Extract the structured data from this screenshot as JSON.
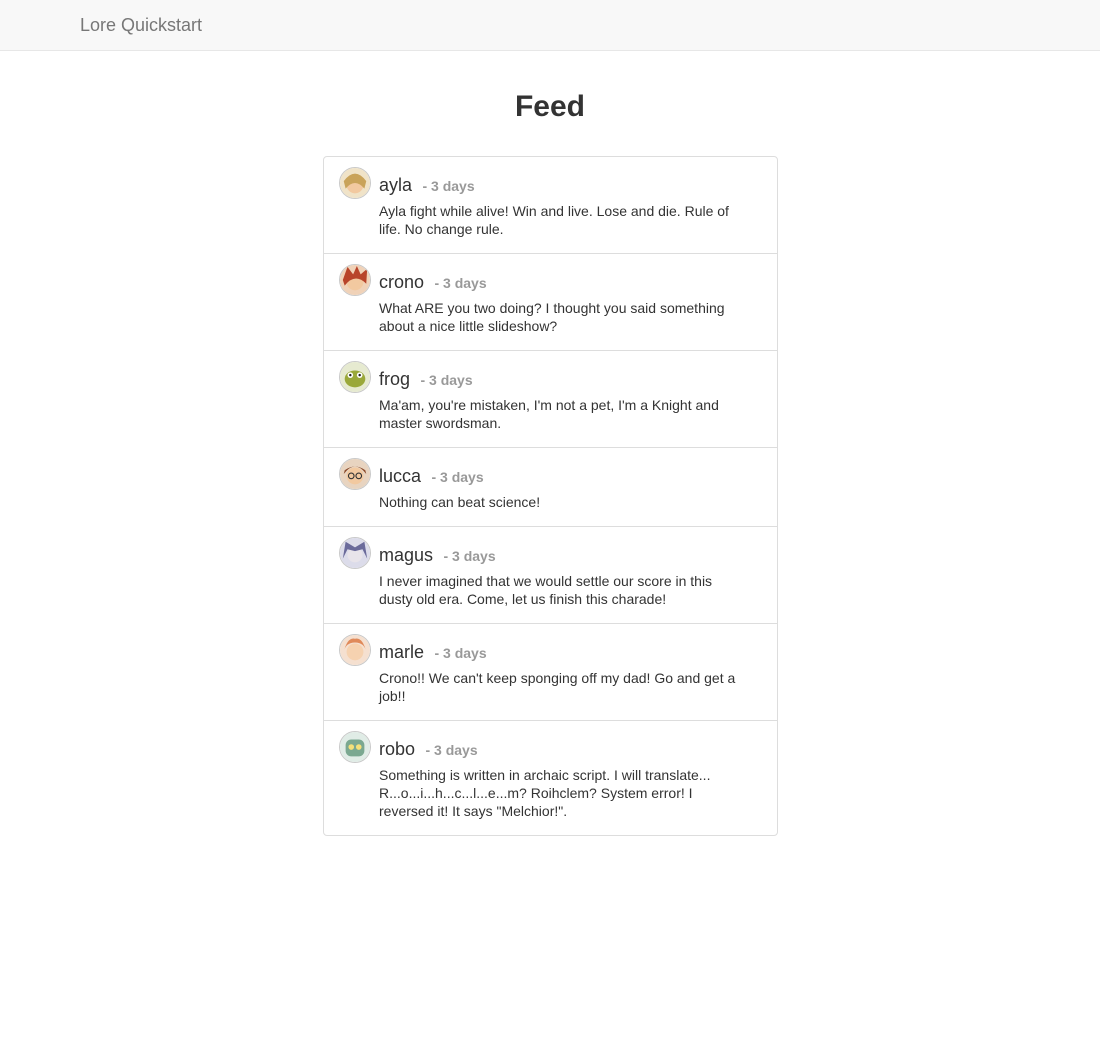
{
  "navbar": {
    "brand": "Lore Quickstart"
  },
  "page": {
    "title": "Feed"
  },
  "feed": {
    "items": [
      {
        "nickname": "ayla",
        "timestamp": "- 3 days",
        "text": "Ayla fight while alive! Win and live. Lose and die. Rule of life. No change rule.",
        "avatar_color": "#c9a35a"
      },
      {
        "nickname": "crono",
        "timestamp": "- 3 days",
        "text": "What ARE you two doing? I thought you said something about a nice little slideshow?",
        "avatar_color": "#b8442a"
      },
      {
        "nickname": "frog",
        "timestamp": "- 3 days",
        "text": "Ma'am, you're mistaken, I'm not a pet, I'm a Knight and master swordsman.",
        "avatar_color": "#9aa83a"
      },
      {
        "nickname": "lucca",
        "timestamp": "- 3 days",
        "text": "Nothing can beat science!",
        "avatar_color": "#8a4a2a"
      },
      {
        "nickname": "magus",
        "timestamp": "- 3 days",
        "text": "I never imagined that we would settle our score in this dusty old era. Come, let us finish this charade!",
        "avatar_color": "#6a6a9a"
      },
      {
        "nickname": "marle",
        "timestamp": "- 3 days",
        "text": "Crono!! We can't keep sponging off my dad! Go and get a job!!",
        "avatar_color": "#e08a5a"
      },
      {
        "nickname": "robo",
        "timestamp": "- 3 days",
        "text": "Something is written in archaic script. I will translate... R...o...i...h...c...l...e...m? Roihclem? System error! I reversed it! It says \"Melchior!\".",
        "avatar_color": "#7aa890"
      }
    ]
  }
}
